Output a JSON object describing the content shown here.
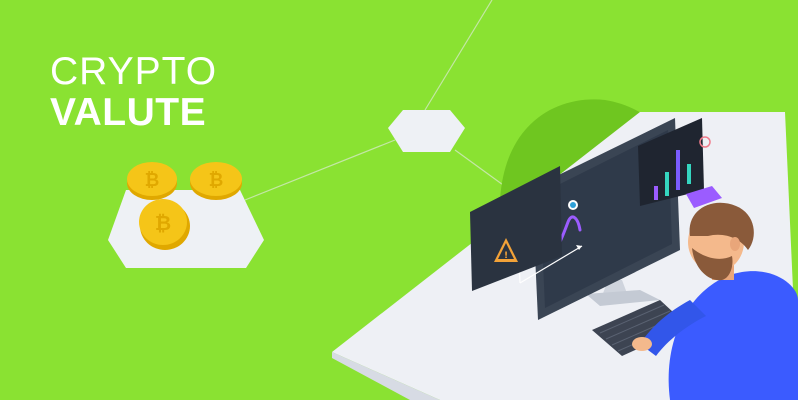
{
  "banner": {
    "title_line1": "CRYPTO",
    "title_line2": "VALUTE"
  },
  "colors": {
    "background": "#8ae232",
    "coin": "#f5c518",
    "desk": "#eef0f5",
    "screen": "#2f3a4a",
    "shirt": "#3b5bff",
    "accent": "#9b5cff"
  },
  "icons": [
    "bitcoin-coin-icon",
    "warning-triangle-icon",
    "bitcoin-marker-icon"
  ]
}
